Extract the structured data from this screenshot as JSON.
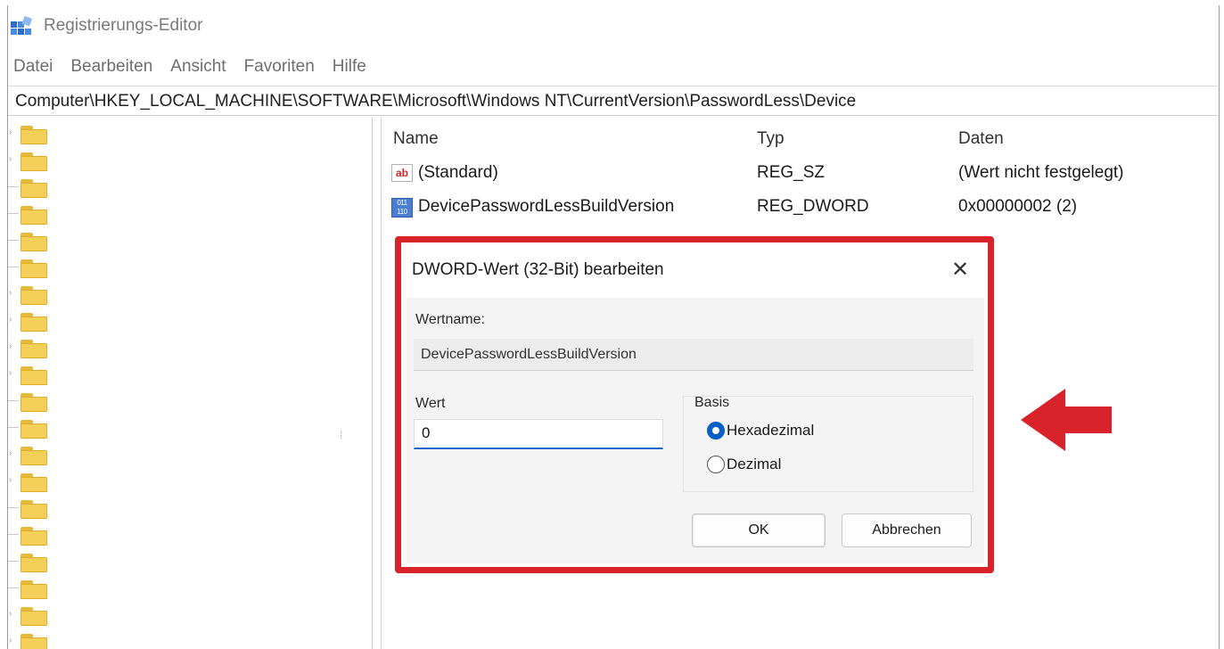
{
  "window": {
    "title": "Registrierungs-Editor"
  },
  "menu": [
    "Datei",
    "Bearbeiten",
    "Ansicht",
    "Favoriten",
    "Hilfe"
  ],
  "address_path": "Computer\\HKEY_LOCAL_MACHINE\\SOFTWARE\\Microsoft\\Windows NT\\CurrentVersion\\PasswordLess\\Device",
  "list": {
    "columns": [
      "Name",
      "Typ",
      "Daten"
    ],
    "rows": [
      {
        "icon": "string-value-icon",
        "name": "(Standard)",
        "type": "REG_SZ",
        "data": "(Wert nicht festgelegt)"
      },
      {
        "icon": "binary-value-icon",
        "name": "DevicePasswordLessBuildVersion",
        "type": "REG_DWORD",
        "data": "0x00000002 (2)"
      }
    ]
  },
  "dialog": {
    "title": "DWORD-Wert (32-Bit) bearbeiten",
    "name_label": "Wertname:",
    "name_value": "DevicePasswordLessBuildVersion",
    "value_label": "Wert",
    "value": "0",
    "base_label": "Basis",
    "base_options": [
      {
        "label": "Hexadezimal",
        "selected": true
      },
      {
        "label": "Dezimal",
        "selected": false
      }
    ],
    "ok_label": "OK",
    "cancel_label": "Abbrechen"
  },
  "icons": {
    "app_icon": "registry-editor-icon",
    "folder_icon": "folder-icon",
    "close_icon": "close-icon",
    "arrow_icon": "red-arrow-left-icon"
  },
  "colors": {
    "highlight_frame": "#d8232a",
    "arrow": "#d8232a",
    "radio_selected": "#0a5fc7",
    "input_focus": "#1e66d0",
    "folder": "#f6cf5a"
  }
}
